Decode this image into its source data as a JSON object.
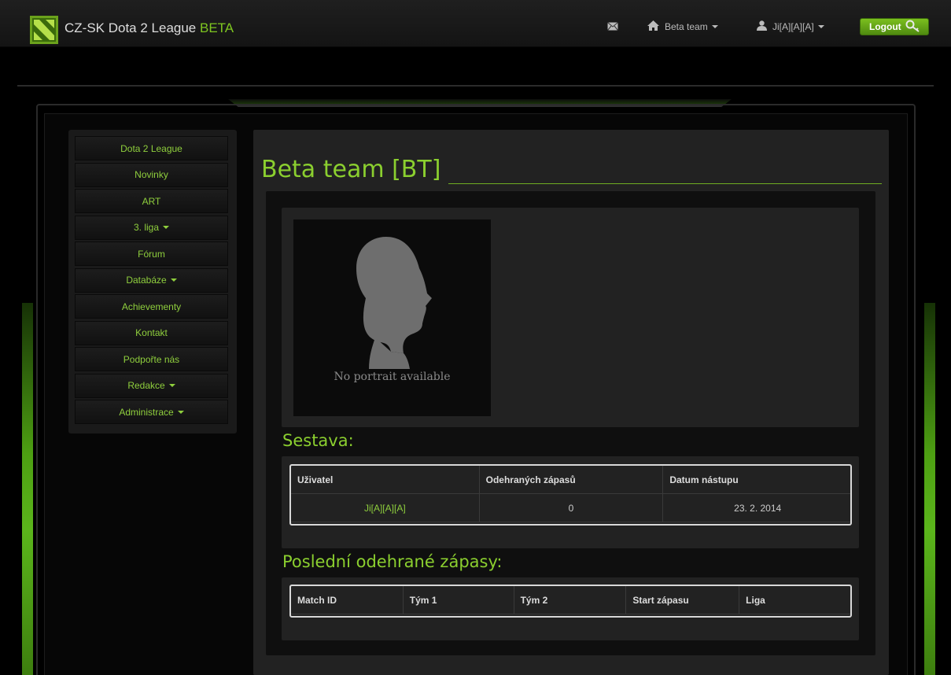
{
  "navbar": {
    "brand": "CZ-SK Dota 2 League",
    "brand_accent": "BETA",
    "team_link": "Beta team",
    "user_link": "Ji[A][A][A]",
    "logout": "Logout"
  },
  "sidebar": {
    "items": [
      {
        "label": "Dota 2 League",
        "dropdown": false
      },
      {
        "label": "Novinky",
        "dropdown": false
      },
      {
        "label": "ART",
        "dropdown": false
      },
      {
        "label": "3. liga",
        "dropdown": true
      },
      {
        "label": "Fórum",
        "dropdown": false
      },
      {
        "label": "Databáze",
        "dropdown": true
      },
      {
        "label": "Achievementy",
        "dropdown": false
      },
      {
        "label": "Kontakt",
        "dropdown": false
      },
      {
        "label": "Podpořte nás",
        "dropdown": false
      },
      {
        "label": "Redakce",
        "dropdown": true
      },
      {
        "label": "Administrace",
        "dropdown": true
      }
    ]
  },
  "main": {
    "title": "Beta team [BT]",
    "portrait_caption": "No portrait available",
    "roster": {
      "heading": "Sestava:",
      "headers": [
        "Uživatel",
        "Odehraných zápasů",
        "Datum nástupu"
      ],
      "rows": [
        [
          "Ji[A][A][A]",
          "0",
          "23. 2. 2014"
        ]
      ]
    },
    "matches": {
      "heading": "Poslední odehrané zápasy:",
      "headers": [
        "Match ID",
        "Tým 1",
        "Tým 2",
        "Start zápasu",
        "Liga"
      ]
    }
  },
  "colors": {
    "accent": "#8bcf2f",
    "logout_bg": "#6aab1a"
  }
}
